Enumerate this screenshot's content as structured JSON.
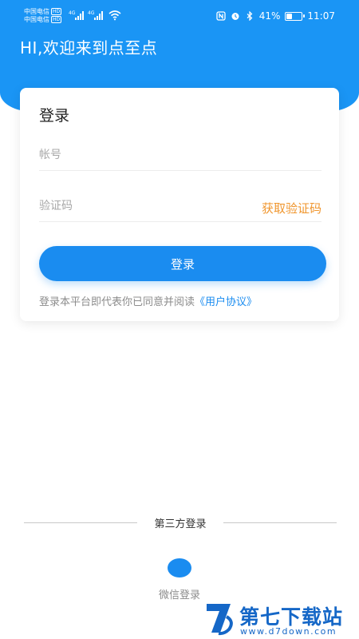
{
  "status_bar": {
    "carrier_1": "中国电信",
    "carrier_2": "中国电信",
    "hd_badge": "HD",
    "network_1": "4G",
    "network_2": "4G",
    "battery_percent": "41%",
    "battery_level": 0.41,
    "time": "11:07",
    "icons": [
      "nfc-icon",
      "alarm-icon",
      "bluetooth-icon",
      "battery-icon",
      "wifi-icon",
      "signal-icon"
    ]
  },
  "header": {
    "greeting": "HI,欢迎来到点至点",
    "background_color": "#1a95f5"
  },
  "login_card": {
    "title": "登录",
    "account_placeholder": "帐号",
    "code_placeholder": "验证码",
    "get_code_label": "获取验证码",
    "login_button": "登录",
    "agreement_prefix": "登录本平台即代表你已同意并阅读",
    "agreement_link": "《用户协议》"
  },
  "third_party": {
    "divider_label": "第三方登录",
    "wechat_label": "微信登录"
  },
  "watermark": {
    "title": "第七下载站",
    "url": "www.d7down.com"
  },
  "colors": {
    "accent": "#1a8cf0",
    "orange": "#f0962e"
  }
}
